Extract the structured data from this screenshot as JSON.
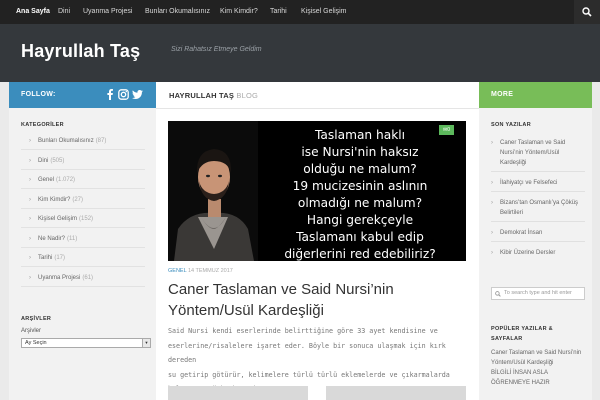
{
  "nav": {
    "items": [
      "Ana Sayfa",
      "Dini",
      "Uyanma Projesi",
      "Bunları Okumalısınız",
      "Kim Kimdir?",
      "Tarihi",
      "Kişisel Gelişim"
    ]
  },
  "header": {
    "title": "Hayrullah Taş",
    "tagline": "Sizi Rahatsız Etmeye Geldim"
  },
  "left_sidebar": {
    "follow_label": "FOLLOW:",
    "social_icons": [
      "facebook-icon",
      "instagram-icon",
      "twitter-icon"
    ],
    "categories_title": "KATEGORİLER",
    "categories": [
      {
        "name": "Bunları Okumalısınız",
        "count": "(87)"
      },
      {
        "name": "Dini",
        "count": "(505)"
      },
      {
        "name": "Genel",
        "count": "(1.072)"
      },
      {
        "name": "Kim Kimdir?",
        "count": "(27)"
      },
      {
        "name": "Kişisel Gelişim",
        "count": "(152)"
      },
      {
        "name": "Ne Nadir?",
        "count": "(11)"
      },
      {
        "name": "Tarihi",
        "count": "(17)"
      },
      {
        "name": "Uyanma Projesi",
        "count": "(61)"
      }
    ],
    "archives_title": "ARŞİVLER",
    "archives_label": "Arşivler",
    "archives_selected": "Ay Seçin"
  },
  "main": {
    "heading": "HAYRULLAH TAŞ",
    "heading_sub": "BLOG",
    "featured_lines": [
      "Taslaman haklı",
      "ise Nursi'nin haksız",
      "olduğu ne malum?",
      "19 mucizesinin aslının",
      "olmadığı ne malum?",
      "Hangi gerekçeyle",
      "Taslamanı kabul edip",
      "diğerlerini red edebiliriz?"
    ],
    "comment_count": "0",
    "post_category": "GENEL",
    "post_date": "14 TEMMUZ 2017",
    "post_title": "Caner Taslaman ve Said Nursi’nin Yöntem/Usül Kardeşliği",
    "excerpt_lines": [
      "Said Nursi kendi eserlerinde belirttiğine göre 33 ayet kendisine ve",
      "eserlerine/risalelere işaret eder. Böyle bir sonuca ulaşmak için kırk dereden",
      "su getirip götürür, kelimelere türlü türlü eklemelerde ve çıkarmalarda",
      "bulunur ve “aha bana işaret…"
    ]
  },
  "right_sidebar": {
    "more_label": "MORE",
    "recent_title": "SON YAZILAR",
    "recent_posts": [
      "Caner Taslaman ve Said Nursi’nin Yöntem/Usül Kardeşliği",
      "İlahiyatçı ve Felsefeci",
      "Bizans’tan Osmanlı’ya Çöküş Belirtileri",
      "Demokrat İnsan",
      "Kibir Üzerine Dersler"
    ],
    "search_placeholder": "To search type and hit enter",
    "popular_title": "POPÜLER YAZILAR & SAYFALAR",
    "popular_items": [
      "Caner Taslaman ve Said Nursi’nin Yöntem/Usül Kardeşliği",
      "BİLGİLİ İNSAN ASLA ÖĞRENMEYE HAZIR"
    ]
  },
  "colors": {
    "follow_bar": "#3b8dbd",
    "more_bar": "#78bd58",
    "header_bg": "#34383c",
    "nav_bg": "#222222",
    "badge": "#5cb85c"
  }
}
